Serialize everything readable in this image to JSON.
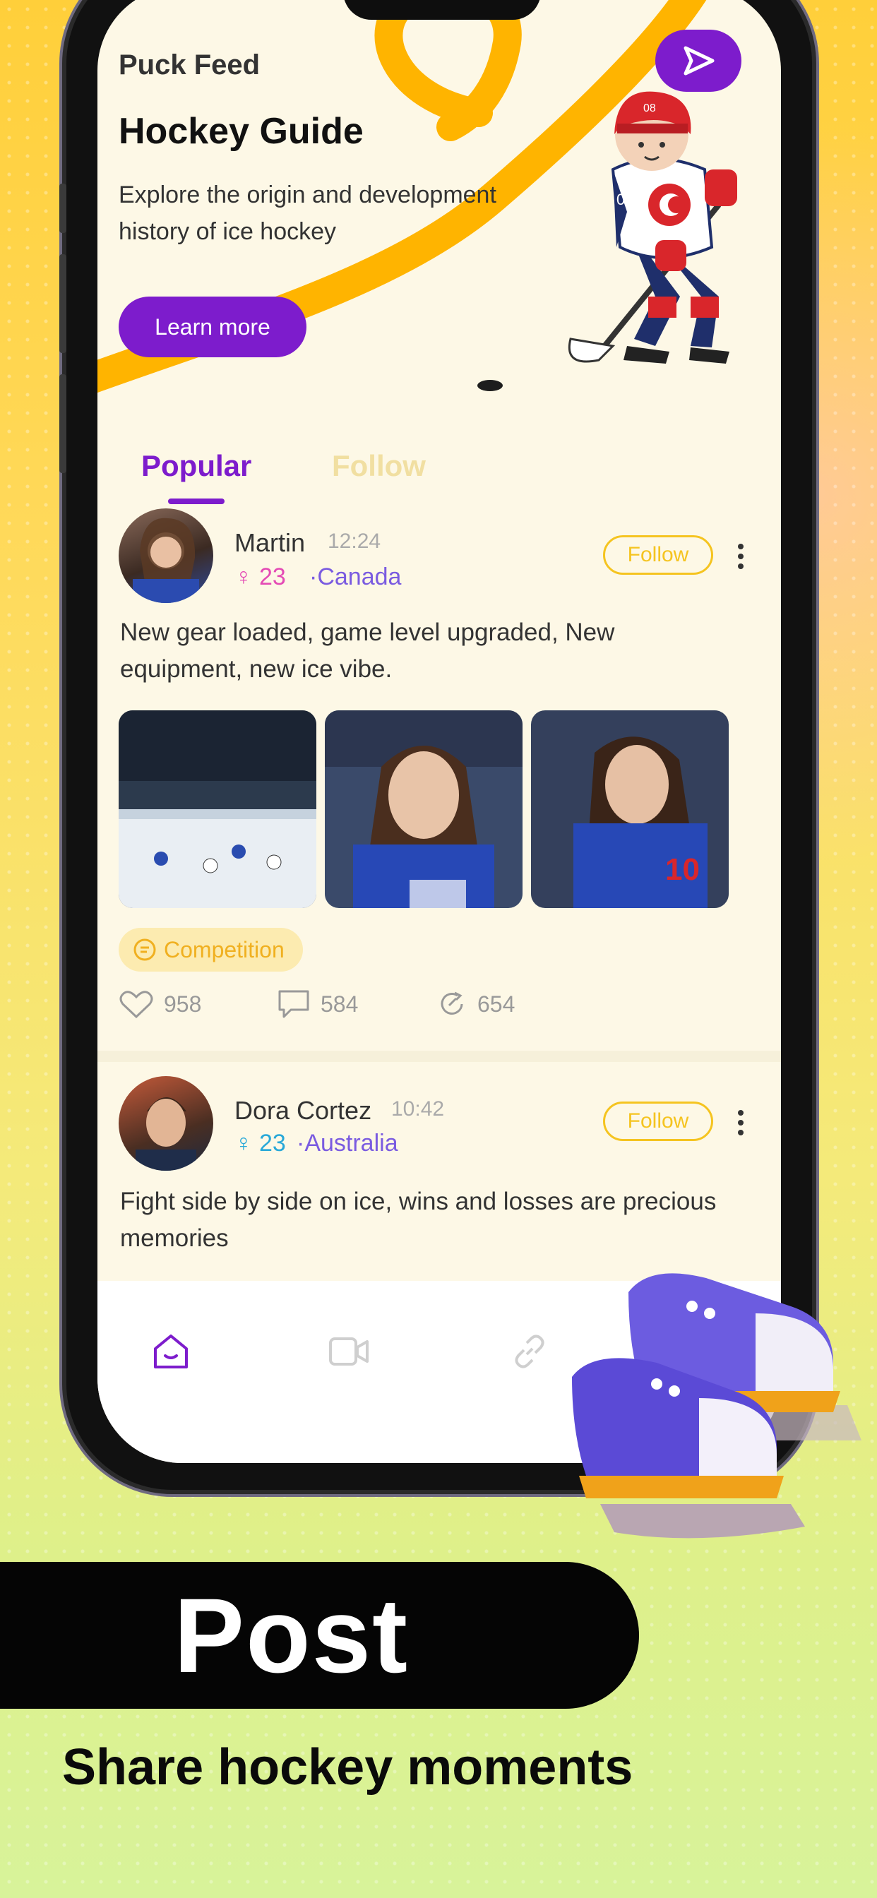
{
  "app": {
    "title": "Puck Feed"
  },
  "banner": {
    "title": "Hockey Guide",
    "description": "Explore the origin and development history of ice hockey",
    "button": "Learn more",
    "player_number": "08"
  },
  "tabs": [
    {
      "label": "Popular",
      "active": true
    },
    {
      "label": "Follow",
      "active": false
    }
  ],
  "posts": [
    {
      "user": "Martin",
      "time": "12:24",
      "gender_symbol": "♀",
      "age": "23",
      "country": "·Canada",
      "follow_label": "Follow",
      "text": "New gear loaded, game level upgraded,  New equipment, new ice vibe.",
      "tag": "Competition",
      "likes": "958",
      "comments": "584",
      "shares": "654"
    },
    {
      "user": "Dora Cortez",
      "time": "10:42",
      "gender_symbol": "♀",
      "age": "23",
      "country": "·Australia",
      "follow_label": "Follow",
      "text": "Fight side by side on ice, wins and losses are precious memories"
    }
  ],
  "tabbar": {
    "items": [
      "home-icon",
      "video-icon",
      "link-icon",
      "profile-icon"
    ],
    "active_color": "#7d1ccc"
  },
  "promo": {
    "headline": "Post",
    "subheadline": "Share hockey moments"
  },
  "colors": {
    "accent": "#7d1ccc",
    "follow": "#f5c420",
    "female": "#e44ab5",
    "male": "#28a8d8",
    "country": "#7a5be0"
  }
}
